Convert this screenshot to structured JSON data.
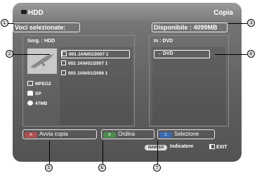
{
  "header": {
    "title": "HDD",
    "mode": "Copia"
  },
  "left_bar": {
    "label": "Voci selezionate:"
  },
  "right_bar": {
    "label": "Disponibile : 4099MB"
  },
  "source_panel": {
    "source_label": "Sorg. : HDD",
    "meta": {
      "codec": "MPEG2",
      "quality": "SP",
      "size": "47MB"
    },
    "items": [
      {
        "label": "001 JAN/01/2007 1",
        "selected": true
      },
      {
        "label": "002 JAN/01/2007 1",
        "selected": false
      },
      {
        "label": "003 JAN/01/2006 1",
        "selected": false
      }
    ]
  },
  "dest_panel": {
    "dest_label": "In : DVD",
    "item": "→ DVD"
  },
  "buttons": {
    "a": {
      "key": "A",
      "label": "Avvia copia"
    },
    "b": {
      "key": "B",
      "label": "Ordina"
    },
    "c": {
      "key": "C",
      "label": "Selezione"
    }
  },
  "help": {
    "marker": "MARKER",
    "indicator": "Indicatore",
    "exit": "EXIT"
  },
  "callouts": [
    "①",
    "②",
    "③",
    "④",
    "⑤",
    "⑥",
    "⑦"
  ]
}
